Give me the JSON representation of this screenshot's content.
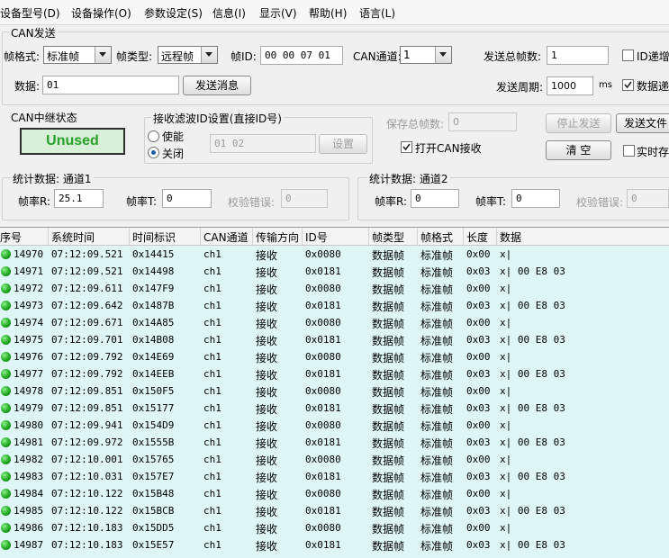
{
  "menu": [
    "设备型号(D)",
    "设备操作(O)",
    "参数设定(S)",
    "信息(I)",
    "显示(V)",
    "帮助(H)",
    "语言(L)"
  ],
  "can_send": {
    "legend": "CAN发送",
    "frame_format_label": "帧格式:",
    "frame_format_value": "标准帧",
    "frame_type_label": "帧类型:",
    "frame_type_value": "远程帧",
    "frame_id_label": "帧ID:",
    "frame_id_value": "00 00 07 01",
    "can_channel_label": "CAN通道:",
    "can_channel_value": "1",
    "total_frames_label": "发送总帧数:",
    "total_frames_value": "1",
    "id_increment_label": "ID递增",
    "data_label": "数据:",
    "data_value": "01",
    "send_button": "发送消息",
    "period_label": "发送周期:",
    "period_value": "1000",
    "period_unit": "ms",
    "data_increment_label": "数据递"
  },
  "relay": {
    "legend": "CAN中继状态",
    "status": "Unused"
  },
  "filter": {
    "legend": "接收滤波ID设置(直接ID号)",
    "enable_label": "使能",
    "disable_label": "关闭",
    "value": "01 02",
    "set_button": "设置"
  },
  "save": {
    "total_label": "保存总帧数:",
    "total_value": "0",
    "open_can_receive_label": "打开CAN接收",
    "stop_send_button": "停止发送",
    "send_file_button": "发送文件",
    "clear_button": "清 空",
    "realtime_save_label": "实时存"
  },
  "stats1": {
    "legend": "统计数据: 通道1",
    "rate_r_label": "帧率R:",
    "rate_r_value": "25.1",
    "rate_t_label": "帧率T:",
    "rate_t_value": "0",
    "error_label": "校验错误:",
    "error_value": "0"
  },
  "stats2": {
    "legend": "统计数据: 通道2",
    "rate_r_label": "帧率R:",
    "rate_r_value": "0",
    "rate_t_label": "帧率T:",
    "rate_t_value": "0",
    "error_label": "校验错误:",
    "error_value": "0"
  },
  "table": {
    "columns": [
      "序号",
      "系统时间",
      "时间标识",
      "CAN通道",
      "传输方向",
      "ID号",
      "帧类型",
      "帧格式",
      "长度",
      "数据"
    ],
    "rows": [
      [
        "14970",
        "07:12:09.521",
        "0x14415",
        "ch1",
        "接收",
        "0x0080",
        "数据帧",
        "标准帧",
        "0x00",
        "x|"
      ],
      [
        "14971",
        "07:12:09.521",
        "0x14498",
        "ch1",
        "接收",
        "0x0181",
        "数据帧",
        "标准帧",
        "0x03",
        "x| 00 E8 03"
      ],
      [
        "14972",
        "07:12:09.611",
        "0x147F9",
        "ch1",
        "接收",
        "0x0080",
        "数据帧",
        "标准帧",
        "0x00",
        "x|"
      ],
      [
        "14973",
        "07:12:09.642",
        "0x1487B",
        "ch1",
        "接收",
        "0x0181",
        "数据帧",
        "标准帧",
        "0x03",
        "x| 00 E8 03"
      ],
      [
        "14974",
        "07:12:09.671",
        "0x14A85",
        "ch1",
        "接收",
        "0x0080",
        "数据帧",
        "标准帧",
        "0x00",
        "x|"
      ],
      [
        "14975",
        "07:12:09.701",
        "0x14B08",
        "ch1",
        "接收",
        "0x0181",
        "数据帧",
        "标准帧",
        "0x03",
        "x| 00 E8 03"
      ],
      [
        "14976",
        "07:12:09.792",
        "0x14E69",
        "ch1",
        "接收",
        "0x0080",
        "数据帧",
        "标准帧",
        "0x00",
        "x|"
      ],
      [
        "14977",
        "07:12:09.792",
        "0x14EEB",
        "ch1",
        "接收",
        "0x0181",
        "数据帧",
        "标准帧",
        "0x03",
        "x| 00 E8 03"
      ],
      [
        "14978",
        "07:12:09.851",
        "0x150F5",
        "ch1",
        "接收",
        "0x0080",
        "数据帧",
        "标准帧",
        "0x00",
        "x|"
      ],
      [
        "14979",
        "07:12:09.851",
        "0x15177",
        "ch1",
        "接收",
        "0x0181",
        "数据帧",
        "标准帧",
        "0x03",
        "x| 00 E8 03"
      ],
      [
        "14980",
        "07:12:09.941",
        "0x154D9",
        "ch1",
        "接收",
        "0x0080",
        "数据帧",
        "标准帧",
        "0x00",
        "x|"
      ],
      [
        "14981",
        "07:12:09.972",
        "0x1555B",
        "ch1",
        "接收",
        "0x0181",
        "数据帧",
        "标准帧",
        "0x03",
        "x| 00 E8 03"
      ],
      [
        "14982",
        "07:12:10.001",
        "0x15765",
        "ch1",
        "接收",
        "0x0080",
        "数据帧",
        "标准帧",
        "0x00",
        "x|"
      ],
      [
        "14983",
        "07:12:10.031",
        "0x157E7",
        "ch1",
        "接收",
        "0x0181",
        "数据帧",
        "标准帧",
        "0x03",
        "x| 00 E8 03"
      ],
      [
        "14984",
        "07:12:10.122",
        "0x15B48",
        "ch1",
        "接收",
        "0x0080",
        "数据帧",
        "标准帧",
        "0x00",
        "x|"
      ],
      [
        "14985",
        "07:12:10.122",
        "0x15BCB",
        "ch1",
        "接收",
        "0x0181",
        "数据帧",
        "标准帧",
        "0x03",
        "x| 00 E8 03"
      ],
      [
        "14986",
        "07:12:10.183",
        "0x15DD5",
        "ch1",
        "接收",
        "0x0080",
        "数据帧",
        "标准帧",
        "0x00",
        "x|"
      ],
      [
        "14987",
        "07:12:10.183",
        "0x15E57",
        "ch1",
        "接收",
        "0x0181",
        "数据帧",
        "标准帧",
        "0x03",
        "x| 00 E8 03"
      ]
    ]
  },
  "colors": {
    "table_bg": "#dff6f6",
    "status_led": "#1ea81e",
    "relay_status_text": "#2aa02a"
  }
}
